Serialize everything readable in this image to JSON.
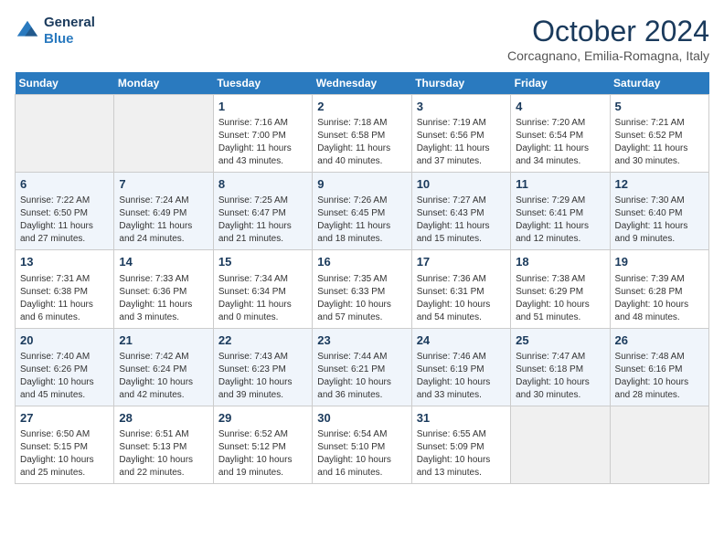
{
  "logo": {
    "line1": "General",
    "line2": "Blue"
  },
  "title": "October 2024",
  "location": "Corcagnano, Emilia-Romagna, Italy",
  "days_of_week": [
    "Sunday",
    "Monday",
    "Tuesday",
    "Wednesday",
    "Thursday",
    "Friday",
    "Saturday"
  ],
  "weeks": [
    [
      {
        "day": "",
        "sunrise": "",
        "sunset": "",
        "daylight": ""
      },
      {
        "day": "",
        "sunrise": "",
        "sunset": "",
        "daylight": ""
      },
      {
        "day": "1",
        "sunrise": "Sunrise: 7:16 AM",
        "sunset": "Sunset: 7:00 PM",
        "daylight": "Daylight: 11 hours and 43 minutes."
      },
      {
        "day": "2",
        "sunrise": "Sunrise: 7:18 AM",
        "sunset": "Sunset: 6:58 PM",
        "daylight": "Daylight: 11 hours and 40 minutes."
      },
      {
        "day": "3",
        "sunrise": "Sunrise: 7:19 AM",
        "sunset": "Sunset: 6:56 PM",
        "daylight": "Daylight: 11 hours and 37 minutes."
      },
      {
        "day": "4",
        "sunrise": "Sunrise: 7:20 AM",
        "sunset": "Sunset: 6:54 PM",
        "daylight": "Daylight: 11 hours and 34 minutes."
      },
      {
        "day": "5",
        "sunrise": "Sunrise: 7:21 AM",
        "sunset": "Sunset: 6:52 PM",
        "daylight": "Daylight: 11 hours and 30 minutes."
      }
    ],
    [
      {
        "day": "6",
        "sunrise": "Sunrise: 7:22 AM",
        "sunset": "Sunset: 6:50 PM",
        "daylight": "Daylight: 11 hours and 27 minutes."
      },
      {
        "day": "7",
        "sunrise": "Sunrise: 7:24 AM",
        "sunset": "Sunset: 6:49 PM",
        "daylight": "Daylight: 11 hours and 24 minutes."
      },
      {
        "day": "8",
        "sunrise": "Sunrise: 7:25 AM",
        "sunset": "Sunset: 6:47 PM",
        "daylight": "Daylight: 11 hours and 21 minutes."
      },
      {
        "day": "9",
        "sunrise": "Sunrise: 7:26 AM",
        "sunset": "Sunset: 6:45 PM",
        "daylight": "Daylight: 11 hours and 18 minutes."
      },
      {
        "day": "10",
        "sunrise": "Sunrise: 7:27 AM",
        "sunset": "Sunset: 6:43 PM",
        "daylight": "Daylight: 11 hours and 15 minutes."
      },
      {
        "day": "11",
        "sunrise": "Sunrise: 7:29 AM",
        "sunset": "Sunset: 6:41 PM",
        "daylight": "Daylight: 11 hours and 12 minutes."
      },
      {
        "day": "12",
        "sunrise": "Sunrise: 7:30 AM",
        "sunset": "Sunset: 6:40 PM",
        "daylight": "Daylight: 11 hours and 9 minutes."
      }
    ],
    [
      {
        "day": "13",
        "sunrise": "Sunrise: 7:31 AM",
        "sunset": "Sunset: 6:38 PM",
        "daylight": "Daylight: 11 hours and 6 minutes."
      },
      {
        "day": "14",
        "sunrise": "Sunrise: 7:33 AM",
        "sunset": "Sunset: 6:36 PM",
        "daylight": "Daylight: 11 hours and 3 minutes."
      },
      {
        "day": "15",
        "sunrise": "Sunrise: 7:34 AM",
        "sunset": "Sunset: 6:34 PM",
        "daylight": "Daylight: 11 hours and 0 minutes."
      },
      {
        "day": "16",
        "sunrise": "Sunrise: 7:35 AM",
        "sunset": "Sunset: 6:33 PM",
        "daylight": "Daylight: 10 hours and 57 minutes."
      },
      {
        "day": "17",
        "sunrise": "Sunrise: 7:36 AM",
        "sunset": "Sunset: 6:31 PM",
        "daylight": "Daylight: 10 hours and 54 minutes."
      },
      {
        "day": "18",
        "sunrise": "Sunrise: 7:38 AM",
        "sunset": "Sunset: 6:29 PM",
        "daylight": "Daylight: 10 hours and 51 minutes."
      },
      {
        "day": "19",
        "sunrise": "Sunrise: 7:39 AM",
        "sunset": "Sunset: 6:28 PM",
        "daylight": "Daylight: 10 hours and 48 minutes."
      }
    ],
    [
      {
        "day": "20",
        "sunrise": "Sunrise: 7:40 AM",
        "sunset": "Sunset: 6:26 PM",
        "daylight": "Daylight: 10 hours and 45 minutes."
      },
      {
        "day": "21",
        "sunrise": "Sunrise: 7:42 AM",
        "sunset": "Sunset: 6:24 PM",
        "daylight": "Daylight: 10 hours and 42 minutes."
      },
      {
        "day": "22",
        "sunrise": "Sunrise: 7:43 AM",
        "sunset": "Sunset: 6:23 PM",
        "daylight": "Daylight: 10 hours and 39 minutes."
      },
      {
        "day": "23",
        "sunrise": "Sunrise: 7:44 AM",
        "sunset": "Sunset: 6:21 PM",
        "daylight": "Daylight: 10 hours and 36 minutes."
      },
      {
        "day": "24",
        "sunrise": "Sunrise: 7:46 AM",
        "sunset": "Sunset: 6:19 PM",
        "daylight": "Daylight: 10 hours and 33 minutes."
      },
      {
        "day": "25",
        "sunrise": "Sunrise: 7:47 AM",
        "sunset": "Sunset: 6:18 PM",
        "daylight": "Daylight: 10 hours and 30 minutes."
      },
      {
        "day": "26",
        "sunrise": "Sunrise: 7:48 AM",
        "sunset": "Sunset: 6:16 PM",
        "daylight": "Daylight: 10 hours and 28 minutes."
      }
    ],
    [
      {
        "day": "27",
        "sunrise": "Sunrise: 6:50 AM",
        "sunset": "Sunset: 5:15 PM",
        "daylight": "Daylight: 10 hours and 25 minutes."
      },
      {
        "day": "28",
        "sunrise": "Sunrise: 6:51 AM",
        "sunset": "Sunset: 5:13 PM",
        "daylight": "Daylight: 10 hours and 22 minutes."
      },
      {
        "day": "29",
        "sunrise": "Sunrise: 6:52 AM",
        "sunset": "Sunset: 5:12 PM",
        "daylight": "Daylight: 10 hours and 19 minutes."
      },
      {
        "day": "30",
        "sunrise": "Sunrise: 6:54 AM",
        "sunset": "Sunset: 5:10 PM",
        "daylight": "Daylight: 10 hours and 16 minutes."
      },
      {
        "day": "31",
        "sunrise": "Sunrise: 6:55 AM",
        "sunset": "Sunset: 5:09 PM",
        "daylight": "Daylight: 10 hours and 13 minutes."
      },
      {
        "day": "",
        "sunrise": "",
        "sunset": "",
        "daylight": ""
      },
      {
        "day": "",
        "sunrise": "",
        "sunset": "",
        "daylight": ""
      }
    ]
  ]
}
